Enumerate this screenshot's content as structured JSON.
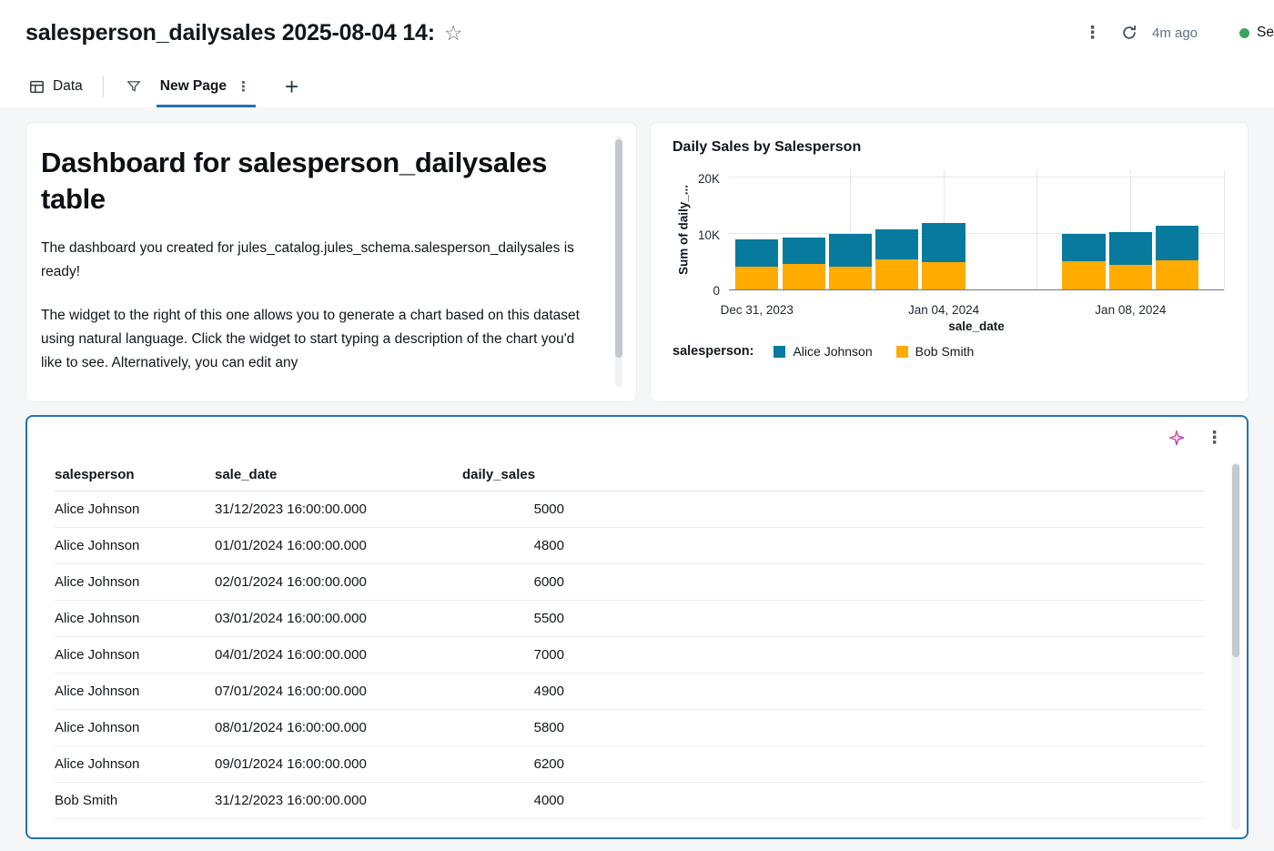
{
  "header": {
    "title": "salesperson_dailysales 2025-08-04 14:",
    "refresh_ago": "4m ago",
    "status_label": "Se"
  },
  "icons": {
    "star": "☆",
    "kebab": "⋮",
    "plus": "+"
  },
  "tabs": {
    "data": "Data",
    "new_page": "New Page"
  },
  "text_widget": {
    "heading": "Dashboard for salesperson_dailysales table",
    "paragraph1": "The dashboard you created for jules_catalog.jules_schema.salesperson_dailysales is ready!",
    "paragraph2": "The widget to the right of this one allows you to generate a chart based on this dataset using natural language. Click the widget to start typing a description of the chart you'd like to see. Alternatively, you can edit any"
  },
  "chart_data": {
    "type": "bar",
    "stacked": true,
    "title": "Daily Sales by Salesperson",
    "xlabel": "sale_date",
    "ylabel": "Sum of daily_...",
    "ylim": [
      0,
      20000
    ],
    "grid": true,
    "legend_position": "bottom",
    "legend_title": "salesperson:",
    "yticks": [
      {
        "label": "0",
        "value": 0
      },
      {
        "label": "10K",
        "value": 10000
      },
      {
        "label": "20K",
        "value": 20000
      }
    ],
    "x_dates": [
      "Dec 31, 2023",
      "Jan 01, 2024",
      "Jan 02, 2024",
      "Jan 03, 2024",
      "Jan 04, 2024",
      "Jan 07, 2024",
      "Jan 08, 2024",
      "Jan 09, 2024"
    ],
    "x_day_index": [
      0,
      1,
      2,
      3,
      4,
      7,
      8,
      9
    ],
    "x_tick_labels": [
      {
        "label": "Dec 31, 2023",
        "day": 0
      },
      {
        "label": "Jan 04, 2024",
        "day": 4
      },
      {
        "label": "Jan 08, 2024",
        "day": 8
      }
    ],
    "series": [
      {
        "name": "Bob Smith",
        "color": "#FFAB00",
        "values": [
          4000,
          4500,
          4000,
          5300,
          4800,
          5100,
          4400,
          5200
        ]
      },
      {
        "name": "Alice Johnson",
        "color": "#077A9D",
        "values": [
          5000,
          4800,
          6000,
          5500,
          7000,
          4900,
          5800,
          6200
        ]
      }
    ],
    "legend": [
      {
        "label": "Alice Johnson",
        "color": "#077A9D"
      },
      {
        "label": "Bob Smith",
        "color": "#FFAB00"
      }
    ]
  },
  "table": {
    "columns": [
      "salesperson",
      "sale_date",
      "daily_sales"
    ],
    "rows": [
      [
        "Alice Johnson",
        "31/12/2023 16:00:00.000",
        "5000"
      ],
      [
        "Alice Johnson",
        "01/01/2024 16:00:00.000",
        "4800"
      ],
      [
        "Alice Johnson",
        "02/01/2024 16:00:00.000",
        "6000"
      ],
      [
        "Alice Johnson",
        "03/01/2024 16:00:00.000",
        "5500"
      ],
      [
        "Alice Johnson",
        "04/01/2024 16:00:00.000",
        "7000"
      ],
      [
        "Alice Johnson",
        "07/01/2024 16:00:00.000",
        "4900"
      ],
      [
        "Alice Johnson",
        "08/01/2024 16:00:00.000",
        "5800"
      ],
      [
        "Alice Johnson",
        "09/01/2024 16:00:00.000",
        "6200"
      ],
      [
        "Bob Smith",
        "31/12/2023 16:00:00.000",
        "4000"
      ]
    ]
  },
  "colors": {
    "accent_blue": "#2272B4",
    "status_green": "#3BA45D",
    "series_teal": "#077A9D",
    "series_amber": "#FFAB00",
    "sparkle_magenta": "#D22DB4"
  }
}
